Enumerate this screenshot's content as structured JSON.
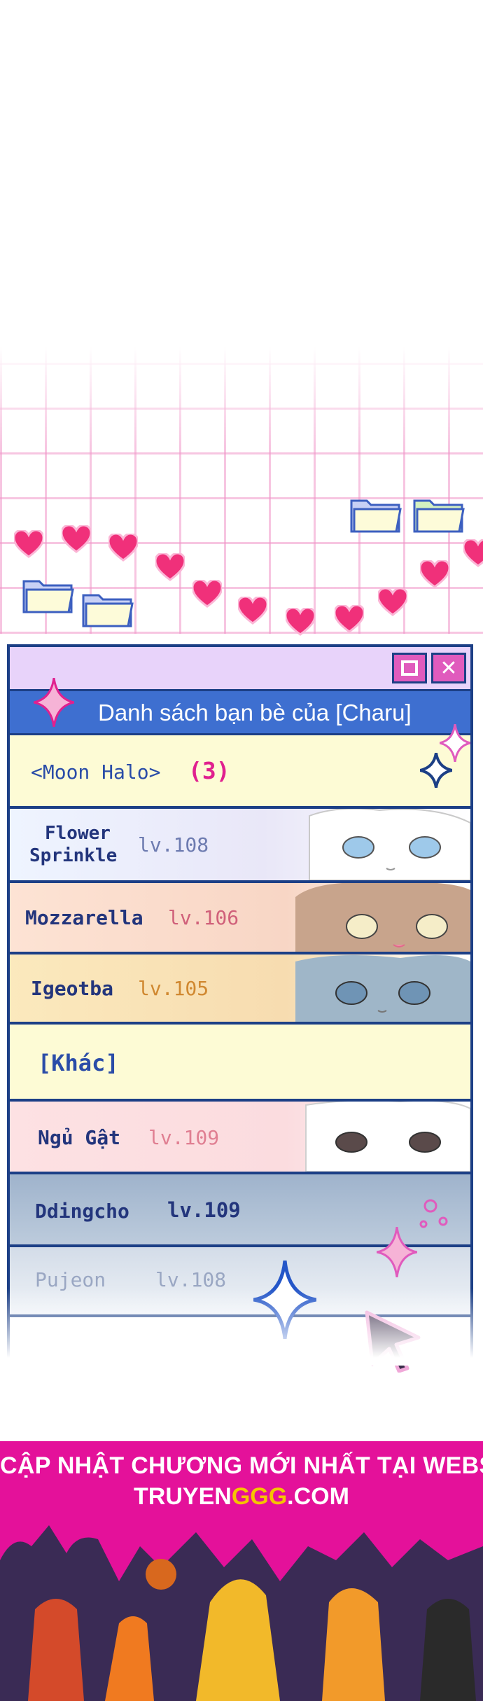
{
  "window": {
    "title": "Danh sách bạn bè của [Charu]",
    "maximize_icon": "maximize-icon",
    "close_icon": "close-icon"
  },
  "groups": [
    {
      "label": "<Moon Halo>",
      "count": "(3)"
    },
    {
      "label": "[Khác]"
    }
  ],
  "friends": [
    {
      "name": "Flower Sprinkle",
      "name_line1": "Flower",
      "name_line2": "Sprinkle",
      "level": "lv.108"
    },
    {
      "name": "Mozzarella",
      "level": "lv.106"
    },
    {
      "name": "Igeotba",
      "level": "lv.105"
    },
    {
      "name": "Ngủ Gật",
      "level": "lv.109"
    },
    {
      "name": "Ddingcho",
      "level": "lv.109"
    },
    {
      "name": "Pujeon",
      "level": "lv.108"
    }
  ],
  "banner": {
    "line1": "CẬP NHẬT CHƯƠNG MỚI NHẤT TẠI WEBSITE",
    "line2_prefix": "TRUYEN",
    "line2_highlight": "GGG",
    "line2_suffix": ".COM"
  },
  "colors": {
    "window_border": "#1c3f86",
    "header_blue": "#3e6fd0",
    "titlebar_lavender": "#e8d3fa",
    "button_pink": "#e05bbd",
    "heart_pink": "#f0307a",
    "banner_magenta": "#e4119a",
    "banner_highlight": "#f5c400"
  }
}
